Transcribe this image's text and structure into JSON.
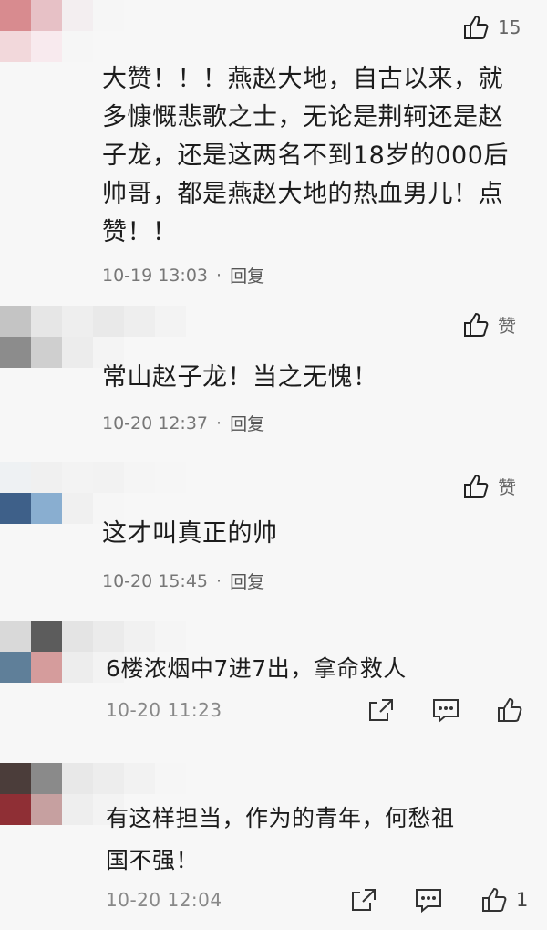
{
  "comments": [
    {
      "avatar_colors": [
        "#d88b8f",
        "#e7c1c6",
        "#f3eef0",
        "#f6f6f6",
        "#f7f7f7",
        "#f7f7f7",
        "#f2d8db",
        "#f8eaee",
        "#f6f6f6",
        "#f7f7f7",
        "#f7f7f7",
        "#f7f7f7"
      ],
      "like_count": "15",
      "text": "大赞！！！燕赵大地，自古以来，就多慷慨悲歌之士，无论是荆轲还是赵子龙，还是这两名不到18岁的000后帅哥，都是燕赵大地的热血男儿！点赞！！",
      "date": "10-19 13:03",
      "reply": "回复"
    },
    {
      "avatar_colors": [
        "#c4c4c4",
        "#e6e6e6",
        "#eeeeee",
        "#e9e9e9",
        "#eeeeee",
        "#f3f3f3",
        "#8c8c8c",
        "#cfcfcf",
        "#ececec",
        "#f4f4f4",
        "#f7f7f7",
        "#f7f7f7"
      ],
      "like_label": "赞",
      "text": "常山赵子龙！当之无愧！",
      "date": "10-20 12:37",
      "reply": "回复"
    },
    {
      "avatar_colors": [
        "#eef1f3",
        "#f0f0f0",
        "#f3f3f3",
        "#f2f2f2",
        "#f5f5f5",
        "#f6f6f6",
        "#3e6089",
        "#89aed0",
        "#f0f0f0",
        "#f6f6f6",
        "#f7f7f7",
        "#f7f7f7"
      ],
      "like_label": "赞",
      "text": "这才叫真正的帅",
      "date": "10-20 15:45",
      "reply": "回复"
    },
    {
      "avatar_colors": [
        "#d9d9d9",
        "#5c5c5c",
        "#e4e4e4",
        "#ebebeb",
        "#f1f1f1",
        "#f5f5f5",
        "#5f7f99",
        "#d59c9c",
        "#ededed",
        "#f3f3f3",
        "#f7f7f7",
        "#f7f7f7"
      ],
      "text": "6楼浓烟中7进7出，拿命救人",
      "date": "10-20 11:23"
    },
    {
      "avatar_colors": [
        "#4b3d3a",
        "#8a8a8a",
        "#e8e8e8",
        "#ededed",
        "#f2f2f2",
        "#f6f6f6",
        "#8f2f35",
        "#c6a0a0",
        "#eeeeee",
        "#f3f3f3",
        "#f7f7f7",
        "#f7f7f7"
      ],
      "text": "有这样担当，作为的青年，何愁祖国不强！",
      "date": "10-20 12:04",
      "like_count": "1"
    }
  ],
  "icons": {
    "thumb": "thumbs-up-icon",
    "share": "share-icon",
    "chat": "comment-icon"
  }
}
